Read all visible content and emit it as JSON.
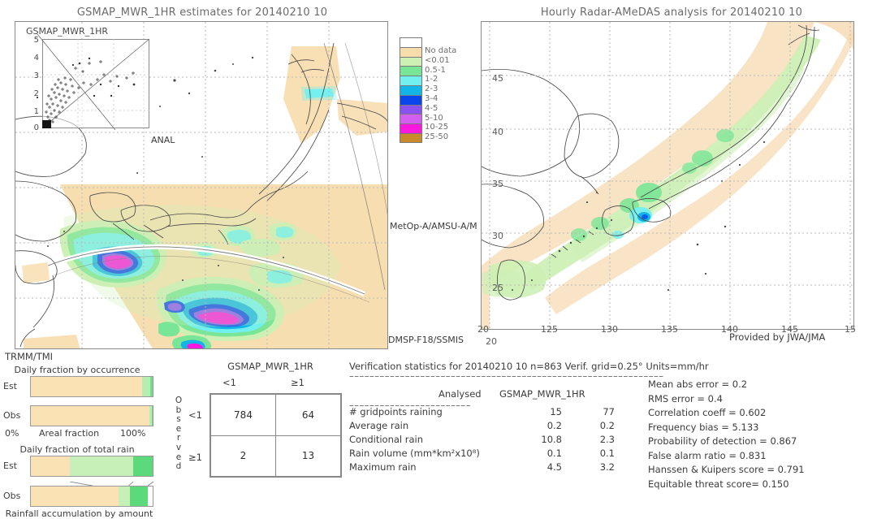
{
  "left_panel": {
    "title": "GSMAP_MWR_1HR estimates for 20140210 10",
    "inset_label": "GSMAP_MWR_1HR",
    "inset_yticks": [
      "5",
      "4",
      "3",
      "2",
      "1",
      "0"
    ],
    "annotations": {
      "anal": "ANAL",
      "metop": "MetOp-A/AMSU-A/M",
      "dmsp": "DMSP-F18/SSMIS"
    }
  },
  "right_panel": {
    "title": "Hourly Radar-AMeDAS analysis for 20140210 10",
    "xticks": [
      "20",
      "125",
      "130",
      "135",
      "140",
      "145",
      "15"
    ],
    "yticks": [
      "45",
      "40",
      "35",
      "30",
      "25",
      "20"
    ],
    "provider": "Provided by JWA/JMA"
  },
  "colorbar": {
    "units": "mm/hr",
    "labels": [
      "No data",
      "<0.01",
      "0.5-1",
      "1-2",
      "2-3",
      "3-4",
      "4-5",
      "5-10",
      "10-25",
      "25-50"
    ],
    "colors": [
      "#ffffff",
      "#f7dcac",
      "#cdf0b5",
      "#79e596",
      "#72f0f0",
      "#13b5e8",
      "#0b46ec",
      "#8a52f0",
      "#d35ef0",
      "#fa18e0",
      "#c98a2c"
    ]
  },
  "fraction_charts": {
    "source_label": "TRMM/TMI",
    "occurrence": {
      "title": "Daily fraction by occurrence",
      "rows": [
        {
          "key": "Est",
          "segments": [
            {
              "color": "#fae2b4",
              "pct": 91
            },
            {
              "color": "#b5eeb0",
              "pct": 7
            },
            {
              "color": "#6fe089",
              "pct": 2
            }
          ]
        },
        {
          "key": "Obs",
          "segments": [
            {
              "color": "#fae2b4",
              "pct": 97
            },
            {
              "color": "#b5eeb0",
              "pct": 2
            },
            {
              "color": "#6fe089",
              "pct": 1
            }
          ]
        }
      ],
      "axis_left": "0%",
      "axis_center": "Areal fraction",
      "axis_right": "100%"
    },
    "total_rain": {
      "title": "Daily fraction of total rain",
      "rows": [
        {
          "key": "Est",
          "segments": [
            {
              "color": "#fae2b4",
              "pct": 32
            },
            {
              "color": "#c6f0b8",
              "pct": 52
            },
            {
              "color": "#5cd97a",
              "pct": 16
            }
          ]
        },
        {
          "key": "Obs",
          "segments": [
            {
              "color": "#fae2b4",
              "pct": 72
            },
            {
              "color": "#c6f0b8",
              "pct": 9
            },
            {
              "color": "#5cd97a",
              "pct": 15
            },
            {
              "color": "#ffffff",
              "pct": 4
            }
          ]
        }
      ],
      "footer": "Rainfall accumulation by amount"
    }
  },
  "contingency_table": {
    "model_name": "GSMAP_MWR_1HR",
    "col_headers": [
      "<1",
      "≥1"
    ],
    "row_axis_label": "Observed",
    "row_headers": [
      "<1",
      "≥1"
    ],
    "cells": [
      [
        "784",
        "64"
      ],
      [
        "2",
        "13"
      ]
    ]
  },
  "verification": {
    "header": "Verification statistics for 20140210 10  n=863  Verif. grid=0.25°  Units=mm/hr",
    "col_analysed": "Analysed",
    "col_model": "GSMAP_MWR_1HR",
    "rows": [
      {
        "name": "# gridpoints raining",
        "analysed": "15",
        "model": "77"
      },
      {
        "name": "Average rain",
        "analysed": "0.2",
        "model": "0.2"
      },
      {
        "name": "Conditional rain",
        "analysed": "10.8",
        "model": "2.3"
      },
      {
        "name": "Rain volume (mm*km²x10⁸)",
        "analysed": "0.1",
        "model": "0.1"
      },
      {
        "name": "Maximum rain",
        "analysed": "4.5",
        "model": "3.2"
      }
    ],
    "scores": [
      "Mean abs error = 0.2",
      "RMS error = 0.4",
      "Correlation coeff = 0.602",
      "Frequency bias = 5.133",
      "Probability of detection = 0.867",
      "False alarm ratio = 0.831",
      "Hanssen & Kuipers score = 0.791",
      "Equitable threat score= 0.150"
    ]
  }
}
